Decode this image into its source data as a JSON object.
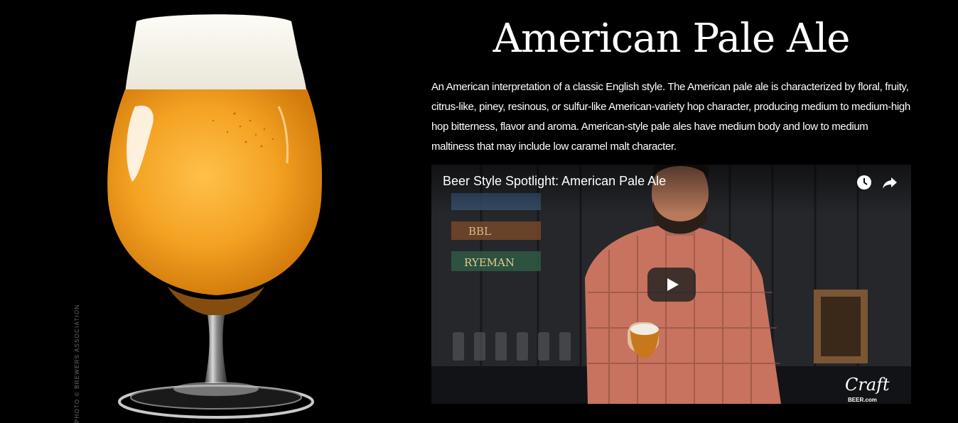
{
  "page": {
    "title": "American Pale Ale",
    "description": "An American interpretation of a classic English style. The American pale ale is characterized by floral, fruity, citrus-like, piney, resinous, or sulfur-like American-variety hop character, producing medium to medium-high hop bitterness, flavor and aroma. American-style pale ales have medium body and low to medium maltiness that may include low caramel malt character."
  },
  "photo": {
    "credit": "PHOTO © BREWERS ASSOCIATION"
  },
  "video": {
    "title": "Beer Style Spotlight: American Pale Ale",
    "logo_text": "Craft",
    "logo_subtext": "BEER.com",
    "sign_texts": [
      "BBL",
      "RYEMAN"
    ]
  },
  "colors": {
    "background": "#000000",
    "beer": "#f0a21f",
    "foam": "#f3f1e8",
    "shirt": "#c8735f"
  }
}
